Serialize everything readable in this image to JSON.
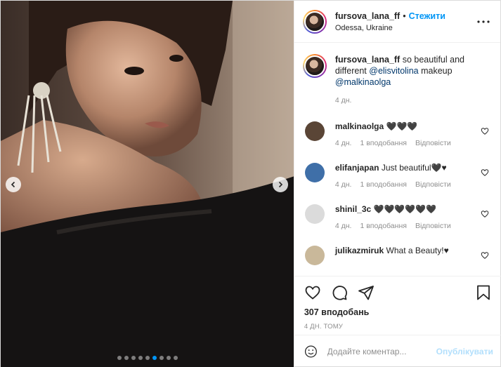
{
  "post": {
    "username": "fursova_lana_ff",
    "separator": "•",
    "follow_label": "Стежити",
    "location": "Odessa, Ukraine",
    "caption": {
      "username": "fursova_lana_ff",
      "text_before": " so beautiful and different ",
      "mention1": "@elisvitolina",
      "text_middle": " makeup ",
      "mention2": "@malkinaolga",
      "time": "4 дн."
    },
    "carousel": {
      "slide_count": 9,
      "active_index": 5
    },
    "likes_label": "307 вподобань",
    "post_time": "4 ДН. ТОМУ"
  },
  "comments": [
    {
      "user": "malkinaolga",
      "text": "🖤🖤🖤",
      "time": "4 дн.",
      "likes": "1 вподобання",
      "reply": "Відповісти",
      "avatar_color": "#5a4536"
    },
    {
      "user": "elifanjapan",
      "text": "Just beautiful🖤♥",
      "time": "4 дн.",
      "likes": "1 вподобання",
      "reply": "Відповісти",
      "avatar_color": "#3f6fa8"
    },
    {
      "user": "shinil_3c",
      "text": "🖤🖤🖤🖤🖤🖤",
      "time": "4 дн.",
      "likes": "1 вподобання",
      "reply": "Відповісти",
      "avatar_color": "#dbdbdb"
    },
    {
      "user": "julikazmiruk",
      "text": "What a Beauty!♥",
      "time": "",
      "likes": "",
      "reply": "",
      "avatar_color": "#c9b89a"
    }
  ],
  "comment_input": {
    "placeholder": "Додайте коментар...",
    "publish_label": "Опублікувати"
  },
  "colors": {
    "accent": "#0095f6",
    "publish_disabled": "#b2dffc",
    "muted": "#8e8e8e",
    "border": "#efefef"
  },
  "icons": [
    "more-icon",
    "chevron-left-icon",
    "chevron-right-icon",
    "heart-icon",
    "comment-icon",
    "share-icon",
    "bookmark-icon",
    "emoji-icon"
  ]
}
